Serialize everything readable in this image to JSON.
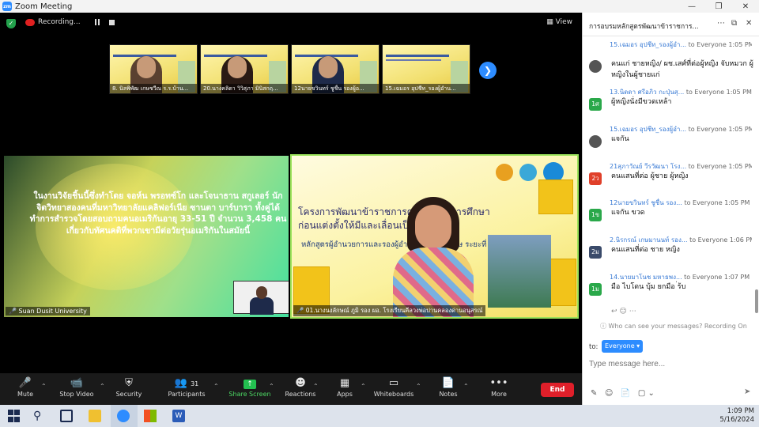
{
  "window": {
    "title": "Zoom Meeting"
  },
  "topbar": {
    "recording": "Recording...",
    "view": "View"
  },
  "thumbnails": [
    {
      "name": "8. นิลพิพัฒ เกษชวีณ  ร.ร.บ้าน..."
    },
    {
      "name": "20.นางคลิดา วิวิสุภา  มินิสกฤ..."
    },
    {
      "name": "12นายขวินทร์ ชูชื่น  รองผู้อ..."
    },
    {
      "name": "15.เฉมอร อุปชีท_รองผู้อำน..."
    }
  ],
  "tile_left": {
    "text": "ในงานวิจัยชิ้นนี้ซึ่งทำโดย จอห์น พรอทซ์โก และโจนาธาน สกูเลอร์ นักจิตวิทยาสองคนที่มหาวิทยาลัยแคลิฟอร์เนีย ซานตา บาร์บารา ทั้งคู่ได้ทำการสำรวจโดยสอบถามคนอเมริกันอายุ 33-51 ปี จำนวน 3,458 คน เกี่ยวกับทัศนคติที่พวกเขามีต่อวัยรุ่นอเมริกันในสมัยนี้",
    "name": "Suan Dusit University"
  },
  "tile_right": {
    "line1": "โครงการพัฒนาข้าราชการครูและบุ...การศึกษา",
    "line2": "ก่อนแต่งตั้งให้มีและเลื่อนเป็นวิทย...",
    "line3": "หลักสูตรผู้อำนวยการและรองผู้อำนวยการข้า...เศษ ระยะที่ 142",
    "name": "01.นางนงลักษณ์ ภูมิ  รอง ผอ. โรงเรียนคีลวงพ่อปานคลองด่านอนุสรณ์"
  },
  "toolbar": {
    "mute": "Mute",
    "stop_video": "Stop Video",
    "security": "Security",
    "participants": "Participants",
    "participants_count": "31",
    "share_screen": "Share Screen",
    "reactions": "Reactions",
    "apps": "Apps",
    "whiteboards": "Whiteboards",
    "notes": "Notes",
    "more": "More",
    "end": "End"
  },
  "chat": {
    "title": "การอบรมหลักสูตรพัฒนาข้าราชการ...",
    "messages": [
      {
        "from": "15.เฉมอร อุปชีท_รองผู้อำ...",
        "to": "to Everyone",
        "time": "1:05 PM",
        "text": ""
      },
      {
        "from": "",
        "to": "",
        "time": "",
        "text": "คนแก่ ชายหญิง/ ผช.เสศ์ที่ต่อผู้หญิง จับหมวก ผู้หญิงในผู้ชายแก่",
        "avatar": "",
        "avatar_color": "#555"
      },
      {
        "from": "13.นิดดา ศรีอภิว กะปุ่นสุ...",
        "to": "to Everyone",
        "time": "1:05 PM",
        "text": "ผู้หญิงนั่งมีขวดเหล้า",
        "avatar": "1ศ",
        "avatar_color": "#2aa84a"
      },
      {
        "from": "15.เฉมอร อุปชีท_รองผู้อำ...",
        "to": "to Everyone",
        "time": "1:05 PM",
        "text": "แจกัน",
        "avatar": "",
        "avatar_color": "#555"
      },
      {
        "from": "21สุภาวัณย์ วีรวัฒนา โรง...",
        "to": "to Everyone",
        "time": "1:05 PM",
        "text": "คนแสนที่ต่อ ผู้ชาย ผู้หญิง",
        "avatar": "2ว",
        "avatar_color": "#e0402a"
      },
      {
        "from": "12นายขวินทร์ ชูชื่น รอง...",
        "to": "to Everyone",
        "time": "1:05 PM",
        "text": "แจกัน ขวด",
        "avatar": "1ข",
        "avatar_color": "#2aa84a"
      },
      {
        "from": "2.นิรกรณ์ เกษมานนท์ รอง...",
        "to": "to Everyone",
        "time": "1:06 PM",
        "text": "คนแสนที่ต่อ ชาย หญิง",
        "avatar": "2ม",
        "avatar_color": "#3a4a6a"
      },
      {
        "from": "14.นายมาโนช มหาธพง...",
        "to": "to Everyone",
        "time": "1:07 PM",
        "text": "มือ ไบโดน บุ้ม ยกมือ ่ร้บ",
        "avatar": "1ม",
        "avatar_color": "#2aa84a"
      }
    ],
    "who_can_see": "Who can see your messages? Recording On",
    "to_label": "to:",
    "to_value": "Everyone",
    "placeholder": "Type message here..."
  },
  "taskbar": {
    "time": "1:09 PM",
    "date": "5/16/2024"
  }
}
